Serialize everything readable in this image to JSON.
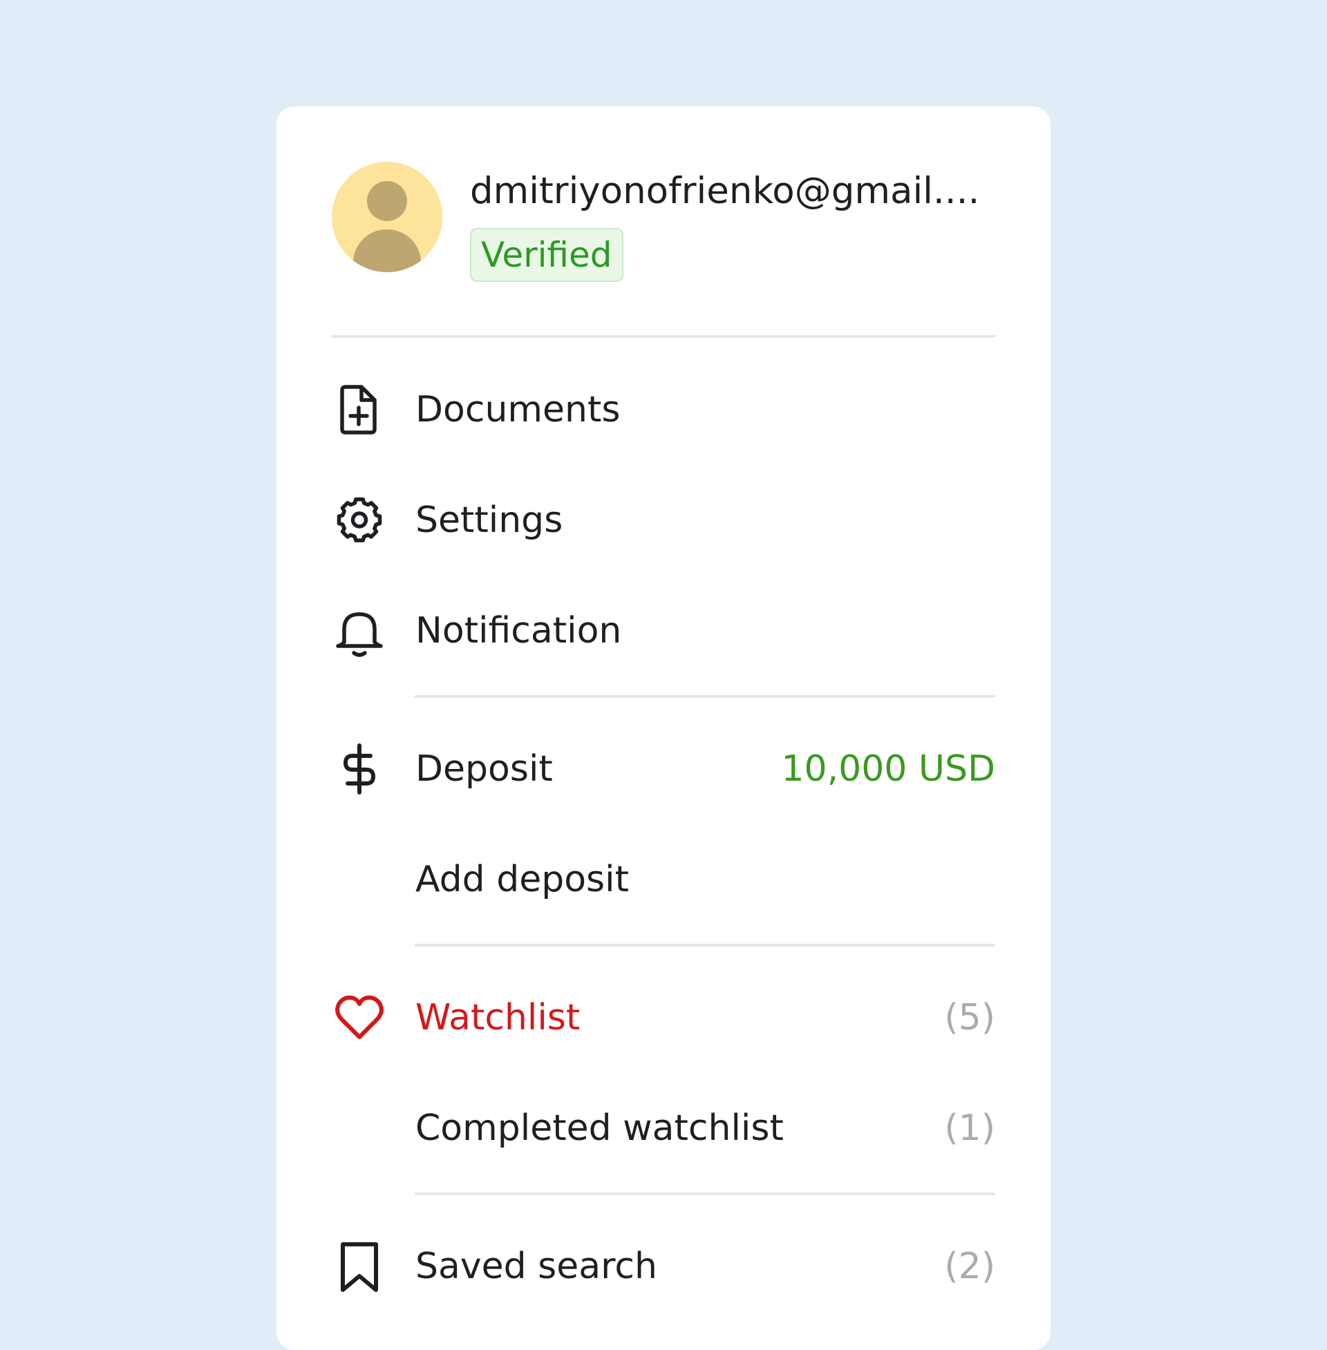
{
  "profile": {
    "email": "dmitriyonofrienko@gmail....",
    "status_badge": "Verified",
    "avatar_icon": "user-silhouette-icon"
  },
  "menu": {
    "documents": {
      "label": "Documents",
      "icon": "document-add-icon"
    },
    "settings": {
      "label": "Settings",
      "icon": "gear-icon"
    },
    "notification": {
      "label": "Notification",
      "icon": "bell-icon"
    },
    "deposit": {
      "label": "Deposit",
      "icon": "dollar-icon",
      "value": "10,000 USD"
    },
    "add_deposit": {
      "label": "Add deposit"
    },
    "watchlist": {
      "label": "Watchlist",
      "icon": "heart-icon",
      "count": "(5)"
    },
    "completed_watchlist": {
      "label": "Completed watchlist",
      "count": "(1)"
    },
    "saved_search": {
      "label": "Saved search",
      "icon": "bookmark-icon",
      "count": "(2)"
    }
  },
  "colors": {
    "background": "#e0edf8",
    "card": "#ffffff",
    "text": "#1f1f23",
    "verified_text": "#2c9a22",
    "verified_bg": "#e9f7e7",
    "deposit_value": "#3a9a1f",
    "watchlist_accent": "#d41818",
    "count": "#a9abb0",
    "avatar_bg": "#fde49a",
    "avatar_figure": "#bea671"
  }
}
